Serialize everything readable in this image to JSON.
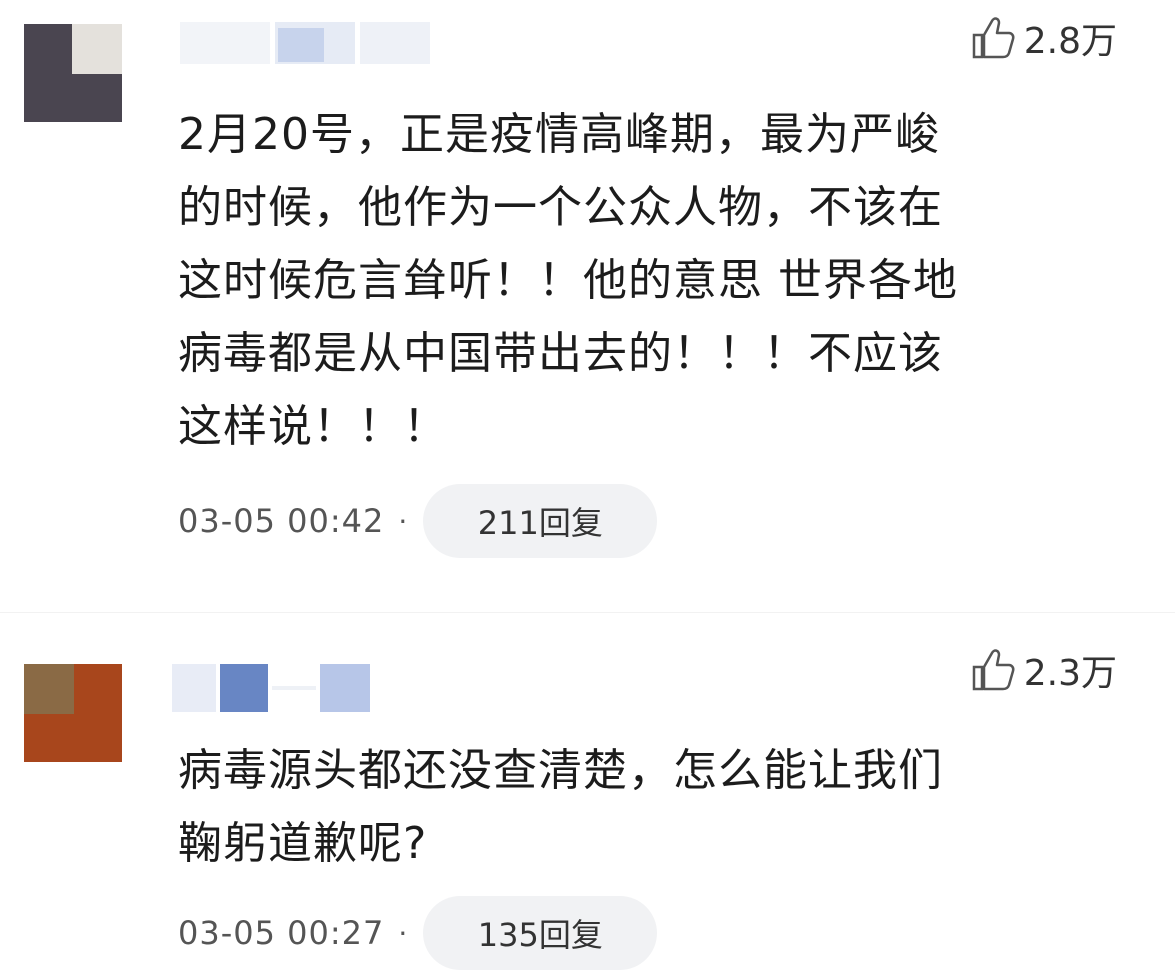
{
  "comments": [
    {
      "likes": "2.8万",
      "text": "2月20号，正是疫情高峰期，最为严峻\n的时候，他作为一个公众人物，不该在\n这时候危言耸听！！他的意思 世界各地\n病毒都是从中国带出去的！！！不应该\n这样说！！！",
      "time": "03-05 00:42",
      "separator": "·",
      "replies": "211回复"
    },
    {
      "likes": "2.3万",
      "text": "病毒源头都还没查清楚，怎么能让我们\n鞠躬道歉呢?",
      "time": "03-05 00:27",
      "separator": "·",
      "replies": "135回复"
    }
  ],
  "colors": {
    "avatar1_dark": "#4a4550",
    "avatar1_light": "#e0ddd8",
    "avatar2_top": "#8a6a45",
    "avatar2_bottom": "#a8461c",
    "name_blur_blue": "#8fa8d8",
    "name_blur_light": "#dce4f4"
  }
}
